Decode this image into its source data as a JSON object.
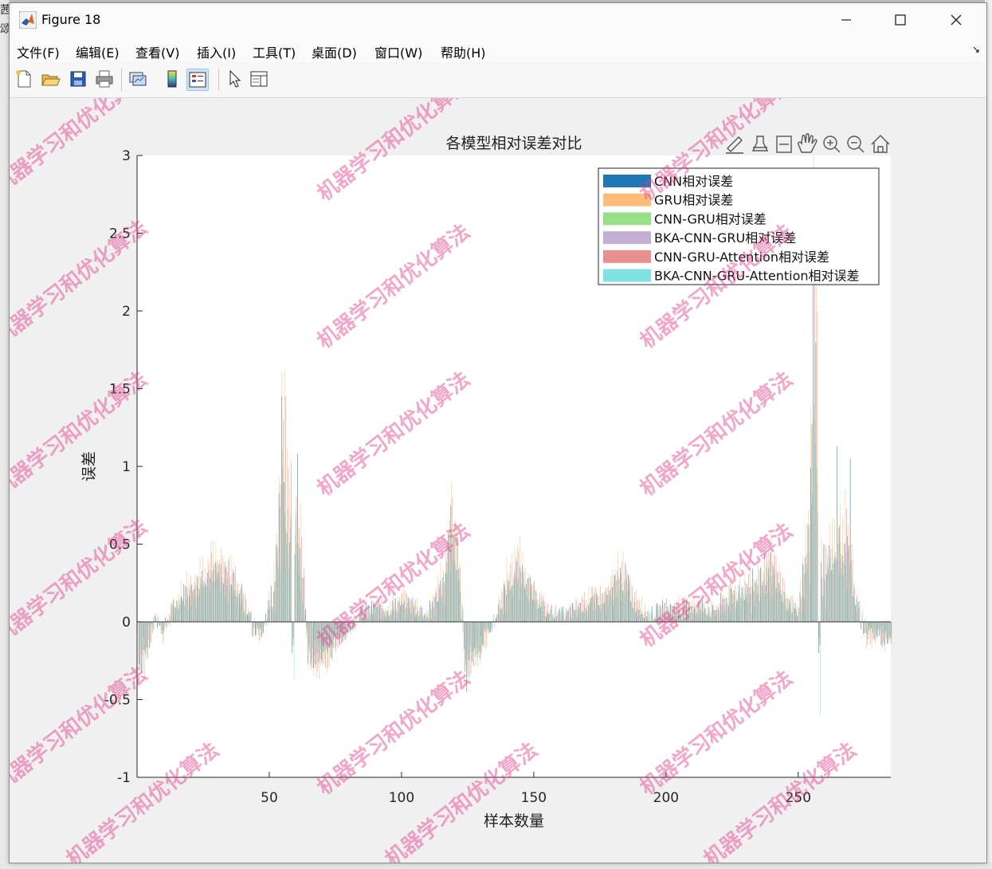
{
  "window": {
    "title": "Figure 18"
  },
  "menu": [
    "文件(F)",
    "编辑(E)",
    "查看(V)",
    "插入(I)",
    "工具(T)",
    "桌面(D)",
    "窗口(W)",
    "帮助(H)"
  ],
  "toolbar": [
    "new-figure-icon",
    "open-file-icon",
    "save-icon",
    "print-icon",
    "link-plot-icon",
    "colorbar-icon",
    "legend-icon",
    "pointer-icon",
    "property-inspector-icon"
  ],
  "axes_toolbar": [
    "brush-icon",
    "data-cursor-icon",
    "data-tips-icon",
    "pan-hand-icon",
    "zoom-in-icon",
    "zoom-out-icon",
    "home-icon"
  ],
  "colors": {
    "CNN": "#1f77b4",
    "GRU": "#ffbb78",
    "CNN-GRU": "#98df8a",
    "BKA-CNN-GRU": "#c5b0d5",
    "CNN-GRU-Attention": "#e8908e",
    "BKA-CNN-GRU-Attention": "#7fe3e3"
  },
  "watermark": "机器学习和优化算法",
  "chart_data": {
    "type": "bar",
    "title": "各模型相对误差对比",
    "xlabel": "样本数量",
    "ylabel": "误差",
    "xlim": [
      0,
      285
    ],
    "ylim": [
      -1,
      3
    ],
    "xticks": [
      50,
      100,
      150,
      200,
      250
    ],
    "yticks": [
      -1,
      -0.5,
      0,
      0.5,
      1,
      1.5,
      2,
      2.5,
      3
    ],
    "grid": false,
    "legend_position": "top-right",
    "series_names": [
      "CNN相对误差",
      "GRU相对误差",
      "CNN-GRU相对误差",
      "BKA-CNN-GRU相对误差",
      "CNN-GRU-Attention相对误差",
      "BKA-CNN-GRU-Attention相对误差"
    ],
    "x_start": 1,
    "envelope_note_keys": [
      "x",
      "val",
      "spread"
    ],
    "series_envelope": [
      {
        "x": 1,
        "mean": -0.3,
        "spread": 0.1
      },
      {
        "x": 4,
        "mean": -0.2,
        "spread": 0.1
      },
      {
        "x": 7,
        "mean": 0.04,
        "spread": 0.04
      },
      {
        "x": 10,
        "mean": -0.08,
        "spread": 0.06
      },
      {
        "x": 14,
        "mean": 0.12,
        "spread": 0.06
      },
      {
        "x": 20,
        "mean": 0.25,
        "spread": 0.07
      },
      {
        "x": 28,
        "mean": 0.38,
        "spread": 0.08
      },
      {
        "x": 35,
        "mean": 0.35,
        "spread": 0.09
      },
      {
        "x": 40,
        "mean": 0.2,
        "spread": 0.08
      },
      {
        "x": 44,
        "mean": -0.05,
        "spread": 0.06
      },
      {
        "x": 47,
        "mean": -0.1,
        "spread": 0.05
      },
      {
        "x": 52,
        "mean": 0.25,
        "spread": 0.1
      },
      {
        "x": 55,
        "mean": 1.2,
        "spread": 0.3
      },
      {
        "x": 58,
        "mean": 0.8,
        "spread": 0.25
      },
      {
        "x": 62,
        "mean": 0.5,
        "spread": 0.2
      },
      {
        "x": 65,
        "mean": -0.2,
        "spread": 0.1
      },
      {
        "x": 68,
        "mean": -0.3,
        "spread": 0.06
      },
      {
        "x": 74,
        "mean": -0.2,
        "spread": 0.06
      },
      {
        "x": 78,
        "mean": -0.1,
        "spread": 0.05
      },
      {
        "x": 84,
        "mean": 0.05,
        "spread": 0.05
      },
      {
        "x": 90,
        "mean": 0.1,
        "spread": 0.06
      },
      {
        "x": 96,
        "mean": 0.1,
        "spread": 0.06
      },
      {
        "x": 102,
        "mean": 0.15,
        "spread": 0.06
      },
      {
        "x": 110,
        "mean": 0.05,
        "spread": 0.05
      },
      {
        "x": 116,
        "mean": 0.3,
        "spread": 0.1
      },
      {
        "x": 119,
        "mean": 0.72,
        "spread": 0.15
      },
      {
        "x": 122,
        "mean": 0.35,
        "spread": 0.1
      },
      {
        "x": 124,
        "mean": -0.3,
        "spread": 0.1
      },
      {
        "x": 130,
        "mean": -0.2,
        "spread": 0.06
      },
      {
        "x": 136,
        "mean": 0.05,
        "spread": 0.04
      },
      {
        "x": 140,
        "mean": 0.28,
        "spread": 0.1
      },
      {
        "x": 145,
        "mean": 0.4,
        "spread": 0.08
      },
      {
        "x": 150,
        "mean": 0.2,
        "spread": 0.07
      },
      {
        "x": 155,
        "mean": 0.08,
        "spread": 0.05
      },
      {
        "x": 162,
        "mean": 0.05,
        "spread": 0.05
      },
      {
        "x": 170,
        "mean": 0.15,
        "spread": 0.06
      },
      {
        "x": 178,
        "mean": 0.2,
        "spread": 0.07
      },
      {
        "x": 184,
        "mean": 0.35,
        "spread": 0.12
      },
      {
        "x": 188,
        "mean": 0.15,
        "spread": 0.06
      },
      {
        "x": 194,
        "mean": 0.05,
        "spread": 0.05
      },
      {
        "x": 200,
        "mean": 0.1,
        "spread": 0.06
      },
      {
        "x": 206,
        "mean": 0.1,
        "spread": 0.06
      },
      {
        "x": 212,
        "mean": 0.12,
        "spread": 0.06
      },
      {
        "x": 218,
        "mean": 0.08,
        "spread": 0.06
      },
      {
        "x": 225,
        "mean": 0.2,
        "spread": 0.08
      },
      {
        "x": 232,
        "mean": 0.25,
        "spread": 0.1
      },
      {
        "x": 240,
        "mean": 0.4,
        "spread": 0.1
      },
      {
        "x": 246,
        "mean": 0.15,
        "spread": 0.06
      },
      {
        "x": 250,
        "mean": 0.08,
        "spread": 0.05
      },
      {
        "x": 254,
        "mean": 0.6,
        "spread": 0.15
      },
      {
        "x": 256,
        "mean": 2.1,
        "spread": 0.4
      },
      {
        "x": 258,
        "mean": 0.3,
        "spread": 0.2
      },
      {
        "x": 262,
        "mean": 0.45,
        "spread": 0.12
      },
      {
        "x": 268,
        "mean": 0.6,
        "spread": 0.15
      },
      {
        "x": 272,
        "mean": 0.15,
        "spread": 0.08
      },
      {
        "x": 276,
        "mean": -0.1,
        "spread": 0.06
      },
      {
        "x": 285,
        "mean": -0.12,
        "spread": 0.06
      }
    ]
  }
}
